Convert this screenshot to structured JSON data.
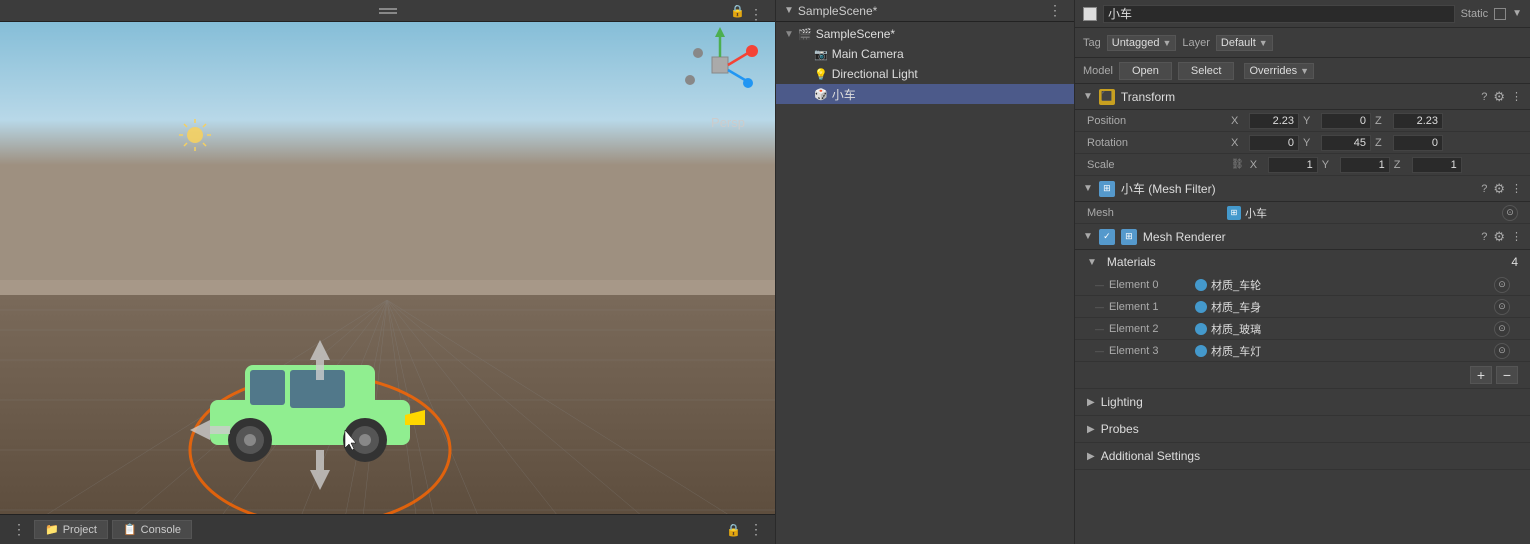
{
  "scene": {
    "persp_label": "Persp",
    "bottom_buttons": [
      "Project",
      "Console"
    ],
    "bottom_dot": "⋮"
  },
  "hierarchy": {
    "title": "SampleScene*",
    "menu_icon": "⋮",
    "items": [
      {
        "label": "SampleScene*",
        "indent": 0,
        "type": "scene",
        "arrow": "▼"
      },
      {
        "label": "Main Camera",
        "indent": 1,
        "type": "camera",
        "arrow": ""
      },
      {
        "label": "Directional Light",
        "indent": 1,
        "type": "light",
        "arrow": ""
      },
      {
        "label": "小车",
        "indent": 1,
        "type": "mesh",
        "arrow": ""
      }
    ]
  },
  "inspector": {
    "tag_label": "Tag",
    "tag_value": "Untagged",
    "layer_label": "Layer",
    "layer_value": "Default",
    "model_label": "Model",
    "open_label": "Open",
    "select_label": "Select",
    "overrides_label": "Overrides",
    "transform": {
      "title": "Transform",
      "position_label": "Position",
      "rotation_label": "Rotation",
      "scale_label": "Scale",
      "position": {
        "x": "2.23",
        "y": "0",
        "z": "2.23"
      },
      "rotation": {
        "x": "0",
        "y": "45",
        "z": "0"
      },
      "scale": {
        "x": "1",
        "y": "1",
        "z": "1"
      }
    },
    "mesh_filter": {
      "title": "小车 (Mesh Filter)",
      "mesh_label": "Mesh",
      "mesh_value": "小车"
    },
    "mesh_renderer": {
      "title": "Mesh Renderer",
      "materials_label": "Materials",
      "materials_count": "4",
      "elements": [
        {
          "label": "Element 0",
          "name": "材质_车轮"
        },
        {
          "label": "Element 1",
          "name": "材质_车身"
        },
        {
          "label": "Element 2",
          "name": "材质_玻璃"
        },
        {
          "label": "Element 3",
          "name": "材质_车灯"
        }
      ]
    },
    "collapsible": [
      {
        "label": "Lighting"
      },
      {
        "label": "Probes"
      },
      {
        "label": "Additional Settings"
      }
    ]
  }
}
